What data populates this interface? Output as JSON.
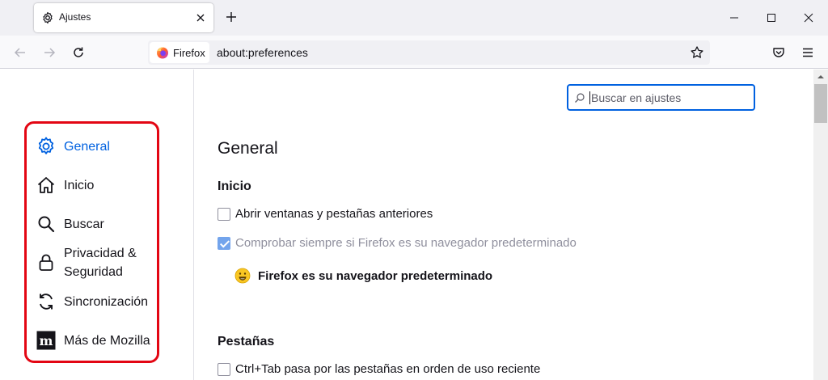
{
  "tab": {
    "title": "Ajustes",
    "icon": "gear-icon",
    "close_icon": "close-icon"
  },
  "window_controls": [
    "minimize-icon",
    "maximize-icon",
    "close-icon"
  ],
  "navbar": {
    "identity_label": "Firefox",
    "url": "about:preferences",
    "buttons": [
      "back-icon",
      "forward-icon",
      "reload-icon",
      "bookmark-star-icon",
      "pocket-icon",
      "menu-icon"
    ]
  },
  "search": {
    "placeholder": "Buscar en ajustes"
  },
  "sidebar": {
    "items": [
      {
        "label": "General",
        "icon": "gear-icon",
        "selected": true
      },
      {
        "label": "Inicio",
        "icon": "home-icon"
      },
      {
        "label": "Buscar",
        "icon": "search-icon"
      },
      {
        "label": "Privacidad & Seguridad",
        "icon": "lock-icon"
      },
      {
        "label": "Sincronización",
        "icon": "sync-icon"
      },
      {
        "label": "Más de Mozilla",
        "icon": "mozilla-icon"
      }
    ]
  },
  "main": {
    "title": "General",
    "startup": {
      "heading": "Inicio",
      "restore_session": {
        "label": "Abrir ventanas y pestañas anteriores",
        "checked": false
      },
      "check_default": {
        "label": "Comprobar siempre si Firefox es su navegador predeterminado",
        "checked": true,
        "disabled": true
      },
      "default_message": "Firefox es su navegador predeterminado"
    },
    "tabs": {
      "heading": "Pestañas",
      "ctrl_tab": {
        "label": "Ctrl+Tab pasa por las pestañas en orden de uso reciente",
        "checked": false
      }
    }
  },
  "colors": {
    "accent": "#0061e0",
    "highlight_border": "#e30613"
  }
}
